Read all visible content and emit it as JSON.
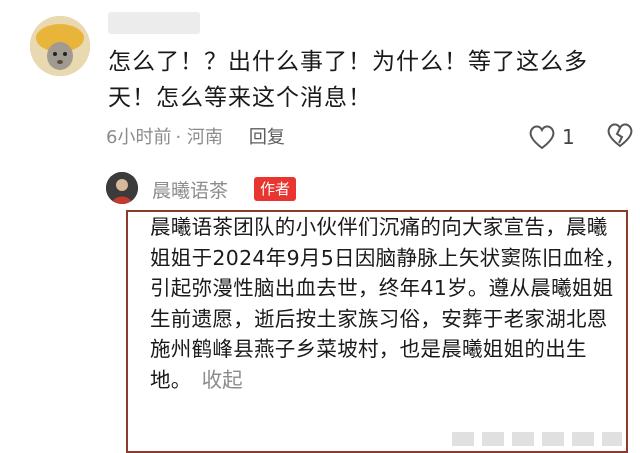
{
  "comment": {
    "text": "怎么了！？出什么事了！为什么！等了这么多天！怎么等来这个消息！",
    "time": "6小时前",
    "location": "· 河南",
    "reply_label": "回复",
    "like_count": "1"
  },
  "author_reply": {
    "name": "晨曦语茶",
    "badge": "作者",
    "text": "晨曦语茶团队的小伙伴们沉痛的向大家宣告，晨曦姐姐于2024年9月5日因脑静脉上矢状窦陈旧血栓，引起弥漫性脑出血去世，终年41岁。遵从晨曦姐姐生前遗愿，逝后按土家族习俗，安葬于老家湖北恩施州鹤峰县燕子乡菜坡村，也是晨曦姐姐的出生地。",
    "collapse_label": "收起"
  },
  "colors": {
    "badge": "#e8352f",
    "box_border": "#8b3a2c",
    "meta": "#8c8c8c"
  },
  "icons": {
    "like": "heart-icon",
    "dislike": "broken-heart-icon"
  }
}
